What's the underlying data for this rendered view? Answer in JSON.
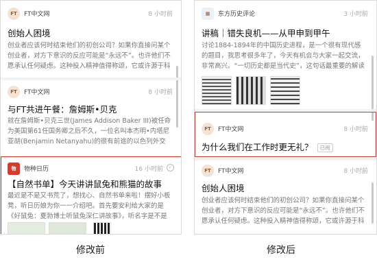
{
  "before": {
    "caption": "修改前",
    "cards": [
      {
        "source": "FT中文网",
        "logo": "FT",
        "time": "8 小时前",
        "title": "创始人困境",
        "snippet": "创业者应该何时结束他们的初创公司？如果你直接问某个创业者，对方下意识的反应可能是“永远不”。也许他们不愿承认任何疑虑。这种投入精神值得称颂，它或许源于科技初"
      },
      {
        "source": "FT中文网",
        "logo": "FT",
        "time": "8 小时前",
        "title": "与FT共进午餐：詹姆斯•贝克",
        "snippet": "就在詹姆斯•贝克三世(James Addison Baker III)被任命为美国第61任国务卿之后不久，一位名叫本杰明•内塔尼亚胡(Benjamin Netanyahu)的很有前途的以色列外交官"
      },
      {
        "source": "物种日历",
        "logo": "物",
        "time": "16 小时前",
        "title": "【自然书单】今天讲讲鼠兔和熊猫的故事",
        "snippet": "最近是不是又书荒了，想找心、自然书单来啦！摆好小板凳，听日历娘为你一一介绍吧。首先要安利给大家的是《好鼠兔：夏勃博士听鼠兔深仁讲故事》，听名字是不是很"
      }
    ]
  },
  "after": {
    "caption": "修改后",
    "cards": [
      {
        "source": "东方历史评论",
        "logo": "▦",
        "time": "3 小时前",
        "title": "讲稿｜错失良机——从甲申到甲午",
        "snippet": "讨论1884-1894年的中国历史进程，是一个很有现代感的题目，我思考很多年了，今天有机会与大家一起交流，非常高兴。“一切历史都是当代史”，这句话最重要的解读是指历"
      },
      {
        "source": "FT中文网",
        "logo": "FT",
        "time": "8 小时前",
        "title": "为什么我们在工作时更无礼？",
        "badge": "已阅"
      },
      {
        "source": "FT中文网",
        "logo": "FT",
        "time": "8 小时前",
        "title": "创始人困境",
        "snippet": "创业者应该何时结束他们的初创公司？如果你直接问某个创业者，对方下意识的反应可能是“永远不”。也许他们不愿承认任何疑虑。这种投入精神值得称颂，它或许源于科技初"
      }
    ]
  }
}
